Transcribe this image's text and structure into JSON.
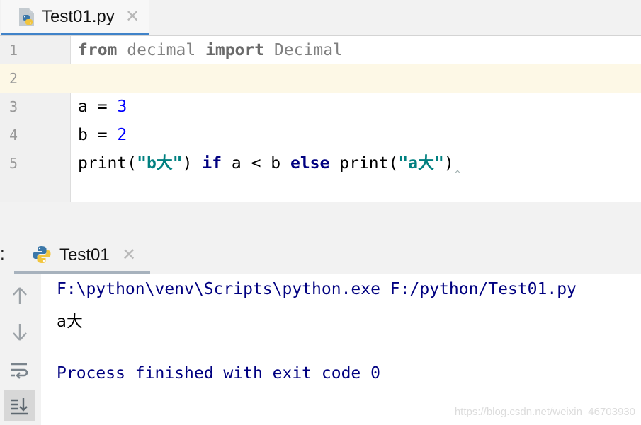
{
  "editor_tab": {
    "label": "Test01.py",
    "close": "✕"
  },
  "code_lines": [
    {
      "n": "1"
    },
    {
      "n": "2"
    },
    {
      "n": "3"
    },
    {
      "n": "4"
    },
    {
      "n": "5"
    }
  ],
  "code": {
    "l1": {
      "from": "from",
      "mod": " decimal ",
      "import": "import",
      "name": " Decimal"
    },
    "l3": {
      "var": "a = ",
      "val": "3"
    },
    "l4": {
      "var": "b = ",
      "val": "2"
    },
    "l5": {
      "p1": "print(",
      "s1": "\"b大\"",
      "p2": ") ",
      "if": "if",
      "p3": " a < b ",
      "else": "else",
      "p4": " print(",
      "s2": "\"a大\"",
      "p5": ")"
    }
  },
  "run_panel": {
    "prefix": ":",
    "tab_label": "Test01",
    "close": "✕"
  },
  "console": {
    "command": "F:\\python\\venv\\Scripts\\python.exe F:/python/Test01.py",
    "output": "a大",
    "exit": "Process finished with exit code 0"
  },
  "watermark": "https://blog.csdn.net/weixin_46703930",
  "colors": {
    "tab_accent": "#4083c9",
    "keyword": "#000080",
    "number": "#0000ff",
    "string": "#008080",
    "current_line": "#fdf8e6"
  }
}
